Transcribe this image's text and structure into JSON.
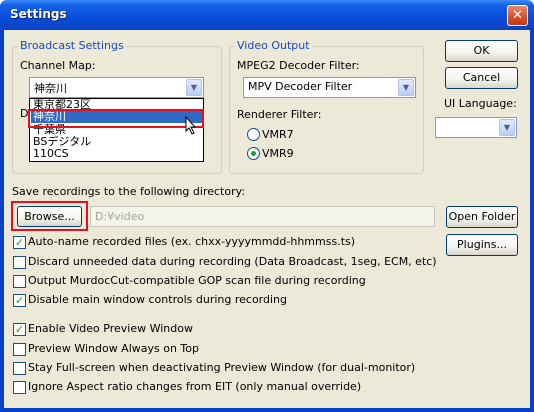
{
  "window": {
    "title": "Settings",
    "close_glyph": "✕"
  },
  "broadcast": {
    "legend": "Broadcast Settings",
    "channel_map_label": "Channel Map:",
    "channel_map_value": "神奈川",
    "channel_options": [
      "東京都23区",
      "神奈川",
      "千葉県",
      "BSデジタル",
      "110CS"
    ],
    "selected_option_index": 1,
    "hidden_label_fragment": "D"
  },
  "video": {
    "legend": "Video Output",
    "decoder_label": "MPEG2 Decoder Filter:",
    "decoder_value": "MPV Decoder Filter",
    "renderer_label": "Renderer Filter:",
    "renderer_options": [
      "VMR7",
      "VMR9"
    ],
    "renderer_selected_index": 1
  },
  "ui_language": {
    "label": "UI Language:",
    "value": ""
  },
  "buttons": {
    "ok": "OK",
    "cancel": "Cancel",
    "open_folder": "Open Folder",
    "plugins": "Plugins...",
    "browse": "Browse..."
  },
  "save": {
    "label": "Save recordings to the following directory:",
    "path": "D:¥video"
  },
  "options": [
    {
      "label": "Auto-name recorded files (ex. chxx-yyyymmdd-hhmmss.ts)",
      "checked": true
    },
    {
      "label": "Discard unneeded data during recording (Data Broadcast, 1seg, ECM, etc)",
      "checked": false
    },
    {
      "label": "Output MurdocCut-compatible GOP scan file during recording",
      "checked": false
    },
    {
      "label": "Disable main window controls during recording",
      "checked": true
    },
    {
      "label": "Enable Video Preview Window",
      "checked": true
    },
    {
      "label": "Preview Window Always on Top",
      "checked": false
    },
    {
      "label": "Stay Full-screen when deactivating Preview Window (for dual-monitor)",
      "checked": false
    },
    {
      "label": "Ignore Aspect ratio changes from EIT (only manual override)",
      "checked": false
    }
  ],
  "icons": {
    "dropdown_arrow": "▼",
    "check": "✓",
    "cursor": "arrow-pointer-icon"
  },
  "colors": {
    "titlebar": "#0a4fd9",
    "highlight": "#316ac5",
    "annotation_red": "#e8111b",
    "legend_text": "#1b48c2",
    "dialog_bg": "#ece9d8"
  }
}
